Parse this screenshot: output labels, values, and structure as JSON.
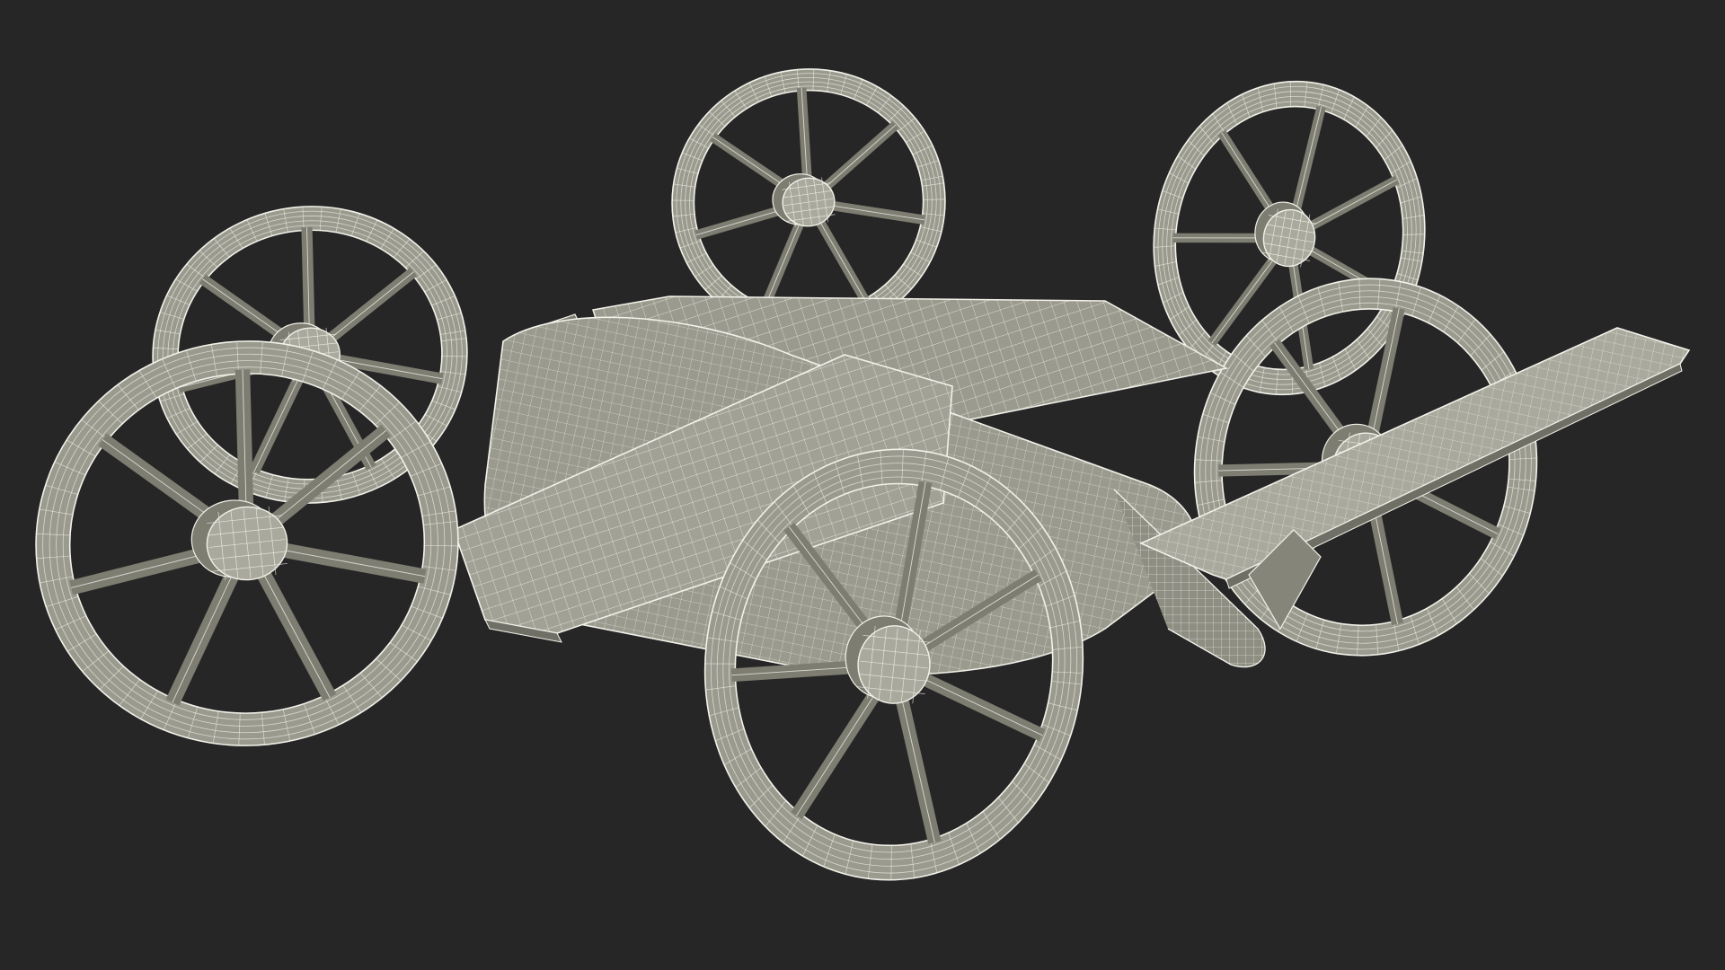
{
  "scene": {
    "background_color": "#262626",
    "surface_color": "#9a9a8e",
    "surface_light_color": "#a9a99d",
    "surface_dark_color": "#7d7d72",
    "wire_color": "#f2f2ea",
    "rotor_count": 6,
    "subject": "wireframe-multirotor-vtol-aircraft-model"
  }
}
